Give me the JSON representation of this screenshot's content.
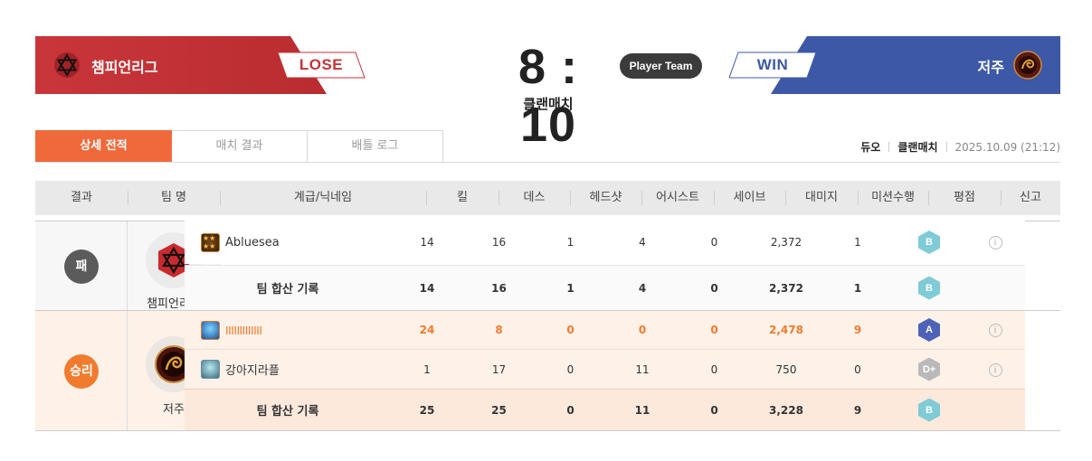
{
  "header": {
    "left_team": {
      "name": "챔피언리그",
      "result": "LOSE",
      "color": "#c43438"
    },
    "right_team": {
      "name": "저주",
      "result": "WIN",
      "color": "#3d58a6"
    },
    "score": "8 : 10",
    "match_type": "클랜매치",
    "player_team_label": "Player Team"
  },
  "tabs": [
    {
      "label": "상세 전적",
      "active": true
    },
    {
      "label": "매치 결과",
      "active": false
    },
    {
      "label": "배틀 로그",
      "active": false
    }
  ],
  "meta": {
    "mode": "듀오",
    "type": "클랜매치",
    "datetime": "2025.10.09 (21:12)"
  },
  "table": {
    "columns": [
      "결과",
      "팀 명",
      "계급/닉네임",
      "킬",
      "데스",
      "헤드샷",
      "어시스트",
      "세이브",
      "대미지",
      "미션수행",
      "평점",
      "신고"
    ],
    "groups": [
      {
        "result": "패",
        "team": "챔피언리그",
        "players": [
          {
            "rank_icon": "gold-star-rank-icon",
            "nickname": "Abluesea",
            "kills": "14",
            "deaths": "16",
            "headshots": "1",
            "assists": "4",
            "saves": "0",
            "damage": "2,372",
            "missions": "1",
            "grade": "B"
          }
        ],
        "total": {
          "label": "팀 합산 기록",
          "kills": "14",
          "deaths": "16",
          "headshots": "1",
          "assists": "4",
          "saves": "0",
          "damage": "2,372",
          "missions": "1",
          "grade": "B"
        }
      },
      {
        "result": "승리",
        "team": "저주",
        "players": [
          {
            "rank_icon": "blue-shield-rank-icon",
            "nickname": "IIIIIIIIIIIII",
            "kills": "24",
            "deaths": "8",
            "headshots": "0",
            "assists": "0",
            "saves": "0",
            "damage": "2,478",
            "missions": "9",
            "grade": "A"
          },
          {
            "rank_icon": "teal-rank-icon",
            "nickname": "강아지라플",
            "kills": "1",
            "deaths": "17",
            "headshots": "0",
            "assists": "11",
            "saves": "0",
            "damage": "750",
            "missions": "0",
            "grade": "D+"
          }
        ],
        "total": {
          "label": "팀 합산 기록",
          "kills": "25",
          "deaths": "25",
          "headshots": "0",
          "assists": "11",
          "saves": "0",
          "damage": "3,228",
          "missions": "9",
          "grade": "B"
        }
      }
    ]
  },
  "report_icon": "i"
}
